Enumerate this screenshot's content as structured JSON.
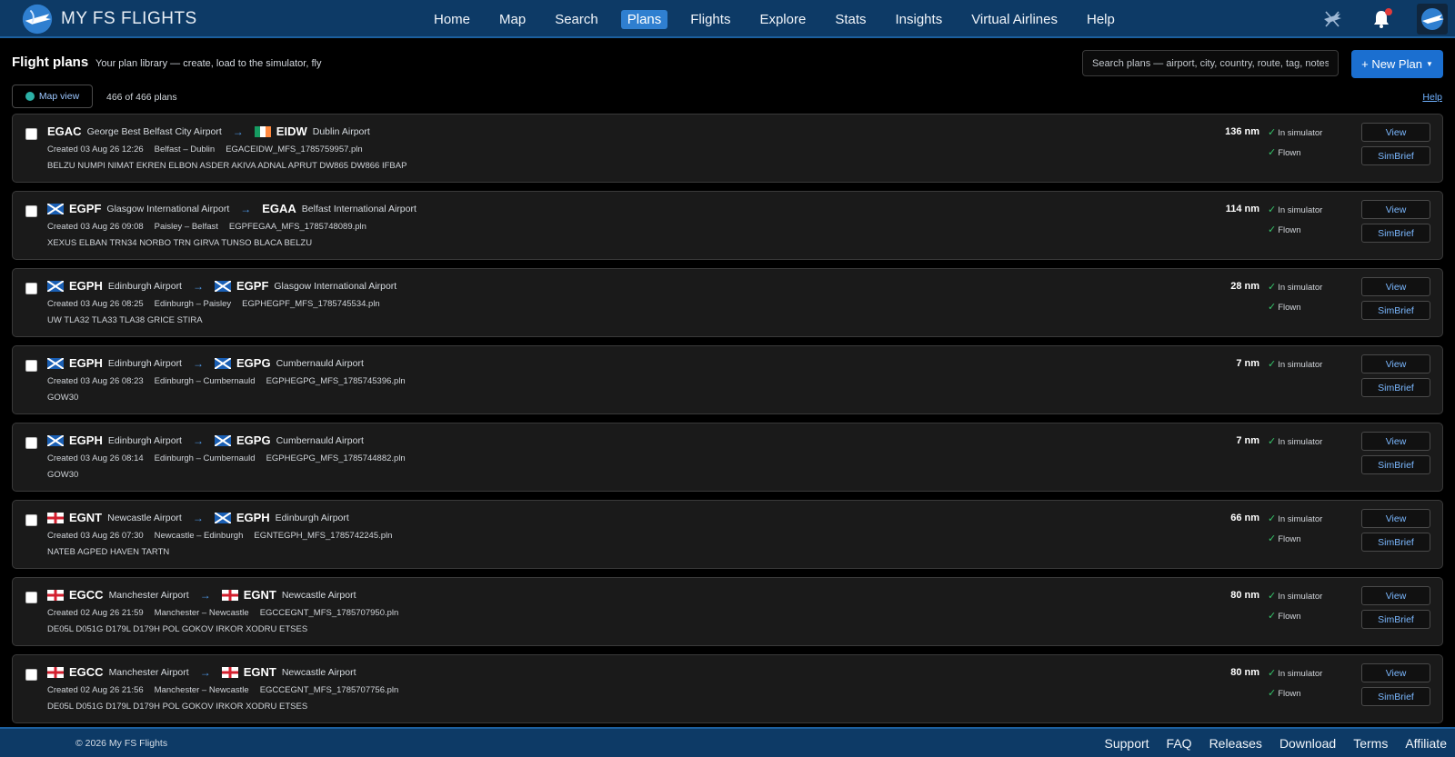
{
  "brand": {
    "name": "MY FS FLIGHTS"
  },
  "nav": {
    "links": [
      "Home",
      "Map",
      "Search",
      "Plans",
      "Flights",
      "Explore",
      "Stats",
      "Insights",
      "Virtual Airlines",
      "Help"
    ],
    "active": "Plans",
    "icons": [
      "flight-tools-icon",
      "bell-icon",
      "avatar"
    ]
  },
  "toolbar": {
    "title": "Flight plans",
    "subtitle": "Your plan library — create, load to the simulator, fly",
    "search_placeholder": "Search plans — airport, city, country, route, tag, notes",
    "new_plan_label": "+ New Plan",
    "map_view_label": "Map view",
    "count": "466 of 466 plans",
    "help_label": "Help"
  },
  "labels": {
    "in_simulator": "In simulator",
    "flown": "Flown",
    "view": "View",
    "simbrief": "SimBrief",
    "arrow": "→",
    "tick": "✓"
  },
  "plans": [
    {
      "from": {
        "icao": "EGAC",
        "name": "George Best Belfast City Airport",
        "flag": "none"
      },
      "to": {
        "icao": "EIDW",
        "name": "Dublin Airport",
        "flag": "ireland"
      },
      "created": "Created 03 Aug 26 12:26",
      "cities": "Belfast – Dublin",
      "file": "EGACEIDW_MFS_1785759957.pln",
      "route": "BELZU NUMPI NIMAT EKREN ELBON ASDER AKIVA ADNAL APRUT DW865 DW866 IFBAP",
      "distance": "136 nm",
      "in_sim": true,
      "flown": true
    },
    {
      "from": {
        "icao": "EGPF",
        "name": "Glasgow International Airport",
        "flag": "scotland"
      },
      "to": {
        "icao": "EGAA",
        "name": "Belfast International Airport",
        "flag": "none"
      },
      "created": "Created 03 Aug 26 09:08",
      "cities": "Paisley – Belfast",
      "file": "EGPFEGAA_MFS_1785748089.pln",
      "route": "XEXUS ELBAN TRN34 NORBO TRN GIRVA TUNSO BLACA BELZU",
      "distance": "114 nm",
      "in_sim": true,
      "flown": true
    },
    {
      "from": {
        "icao": "EGPH",
        "name": "Edinburgh Airport",
        "flag": "scotland"
      },
      "to": {
        "icao": "EGPF",
        "name": "Glasgow International Airport",
        "flag": "scotland"
      },
      "created": "Created 03 Aug 26 08:25",
      "cities": "Edinburgh – Paisley",
      "file": "EGPHEGPF_MFS_1785745534.pln",
      "route": "UW TLA32 TLA33 TLA38 GRICE STIRA",
      "distance": "28 nm",
      "in_sim": true,
      "flown": true
    },
    {
      "from": {
        "icao": "EGPH",
        "name": "Edinburgh Airport",
        "flag": "scotland"
      },
      "to": {
        "icao": "EGPG",
        "name": "Cumbernauld Airport",
        "flag": "scotland"
      },
      "created": "Created 03 Aug 26 08:23",
      "cities": "Edinburgh – Cumbernauld",
      "file": "EGPHEGPG_MFS_1785745396.pln",
      "route": "GOW30",
      "distance": "7 nm",
      "in_sim": true,
      "flown": false
    },
    {
      "from": {
        "icao": "EGPH",
        "name": "Edinburgh Airport",
        "flag": "scotland"
      },
      "to": {
        "icao": "EGPG",
        "name": "Cumbernauld Airport",
        "flag": "scotland"
      },
      "created": "Created 03 Aug 26 08:14",
      "cities": "Edinburgh – Cumbernauld",
      "file": "EGPHEGPG_MFS_1785744882.pln",
      "route": "GOW30",
      "distance": "7 nm",
      "in_sim": true,
      "flown": false
    },
    {
      "from": {
        "icao": "EGNT",
        "name": "Newcastle Airport",
        "flag": "england"
      },
      "to": {
        "icao": "EGPH",
        "name": "Edinburgh Airport",
        "flag": "scotland"
      },
      "created": "Created 03 Aug 26 07:30",
      "cities": "Newcastle – Edinburgh",
      "file": "EGNTEGPH_MFS_1785742245.pln",
      "route": "NATEB AGPED HAVEN TARTN",
      "distance": "66 nm",
      "in_sim": true,
      "flown": true
    },
    {
      "from": {
        "icao": "EGCC",
        "name": "Manchester Airport",
        "flag": "england"
      },
      "to": {
        "icao": "EGNT",
        "name": "Newcastle Airport",
        "flag": "england"
      },
      "created": "Created 02 Aug 26 21:59",
      "cities": "Manchester – Newcastle",
      "file": "EGCCEGNT_MFS_1785707950.pln",
      "route": "DE05L D051G D179L D179H POL GOKOV IRKOR XODRU ETSES",
      "distance": "80 nm",
      "in_sim": true,
      "flown": true
    },
    {
      "from": {
        "icao": "EGCC",
        "name": "Manchester Airport",
        "flag": "england"
      },
      "to": {
        "icao": "EGNT",
        "name": "Newcastle Airport",
        "flag": "england"
      },
      "created": "Created 02 Aug 26 21:56",
      "cities": "Manchester – Newcastle",
      "file": "EGCCEGNT_MFS_1785707756.pln",
      "route": "DE05L D051G D179L D179H POL GOKOV IRKOR XODRU ETSES",
      "distance": "80 nm",
      "in_sim": true,
      "flown": true
    }
  ],
  "footer": {
    "copyright": "© 2026 My FS Flights",
    "links": [
      "Support",
      "FAQ",
      "Releases",
      "Download",
      "Terms",
      "Affiliate"
    ]
  },
  "colors": {
    "navbar": "#0d3a66",
    "accent": "#1b6fd0",
    "active_tab": "#2f7fd0",
    "link": "#7bb8ff",
    "tick": "#36c46a",
    "card_bg": "#1a1a1a"
  }
}
